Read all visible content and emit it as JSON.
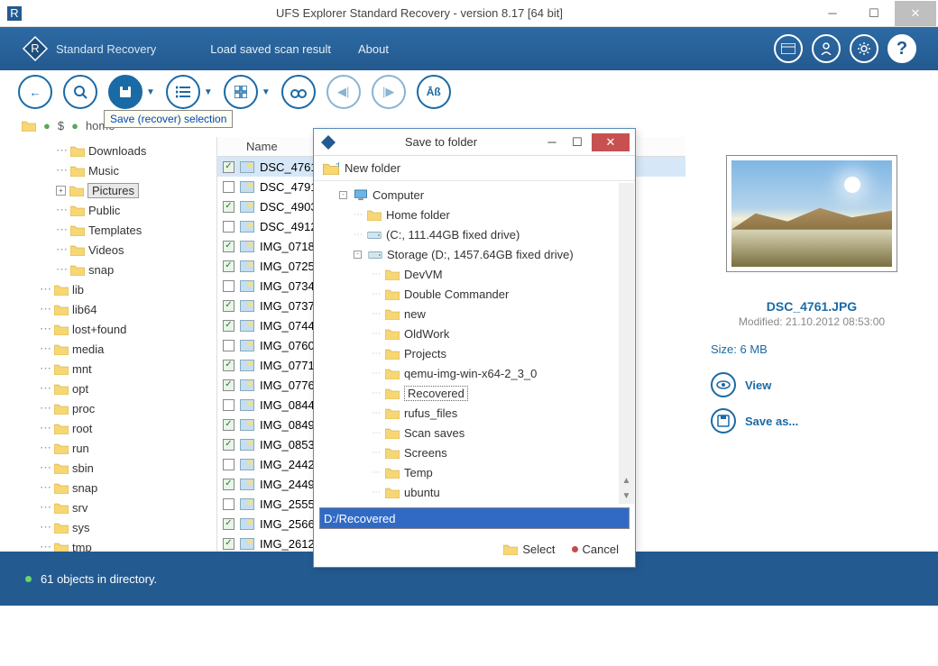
{
  "titlebar": {
    "title": "UFS Explorer Standard Recovery - version 8.17 [64 bit]"
  },
  "header": {
    "brand": "Standard Recovery",
    "menu": [
      "Load saved scan result",
      "About"
    ]
  },
  "toolbar": {
    "tooltip": "Save (recover) selection"
  },
  "breadcrumb": {
    "items": [
      "$",
      "home"
    ]
  },
  "tree": [
    {
      "label": "Downloads",
      "lvl": 2
    },
    {
      "label": "Music",
      "lvl": 2
    },
    {
      "label": "Pictures",
      "lvl": 2,
      "expand": "+",
      "selected": true
    },
    {
      "label": "Public",
      "lvl": 2
    },
    {
      "label": "Templates",
      "lvl": 2
    },
    {
      "label": "Videos",
      "lvl": 2
    },
    {
      "label": "snap",
      "lvl": 2
    },
    {
      "label": "lib",
      "lvl": 1
    },
    {
      "label": "lib64",
      "lvl": 1
    },
    {
      "label": "lost+found",
      "lvl": 1
    },
    {
      "label": "media",
      "lvl": 1
    },
    {
      "label": "mnt",
      "lvl": 1
    },
    {
      "label": "opt",
      "lvl": 1
    },
    {
      "label": "proc",
      "lvl": 1
    },
    {
      "label": "root",
      "lvl": 1
    },
    {
      "label": "run",
      "lvl": 1
    },
    {
      "label": "sbin",
      "lvl": 1
    },
    {
      "label": "snap",
      "lvl": 1
    },
    {
      "label": "srv",
      "lvl": 1
    },
    {
      "label": "sys",
      "lvl": 1
    },
    {
      "label": "tmp",
      "lvl": 1
    }
  ],
  "filelist": {
    "header": "Name",
    "rows": [
      {
        "name": "DSC_4761",
        "chk": true,
        "sel": true
      },
      {
        "name": "DSC_4791",
        "chk": false
      },
      {
        "name": "DSC_4903",
        "chk": true
      },
      {
        "name": "DSC_4912",
        "chk": false
      },
      {
        "name": "IMG_0718",
        "chk": true
      },
      {
        "name": "IMG_0725",
        "chk": true
      },
      {
        "name": "IMG_0734",
        "chk": false
      },
      {
        "name": "IMG_0737",
        "chk": true
      },
      {
        "name": "IMG_0744",
        "chk": true
      },
      {
        "name": "IMG_0760",
        "chk": false
      },
      {
        "name": "IMG_0771",
        "chk": true
      },
      {
        "name": "IMG_0776",
        "chk": true
      },
      {
        "name": "IMG_0844",
        "chk": false
      },
      {
        "name": "IMG_0849",
        "chk": true
      },
      {
        "name": "IMG_0853",
        "chk": true
      },
      {
        "name": "IMG_2442",
        "chk": false
      },
      {
        "name": "IMG_2449",
        "chk": true
      },
      {
        "name": "IMG_2555",
        "chk": false
      },
      {
        "name": "IMG_2566",
        "chk": true
      },
      {
        "name": "IMG_2612",
        "chk": true
      }
    ]
  },
  "preview": {
    "name": "DSC_4761.JPG",
    "modified": "Modified: 21.10.2012 08:53:00",
    "size": "Size: 6 MB",
    "view": "View",
    "saveas": "Save as..."
  },
  "status": "61 objects in directory.",
  "dialog": {
    "title": "Save to folder",
    "newfolder": "New folder",
    "tree": [
      {
        "label": "Computer",
        "lvl": 0,
        "expand": "-",
        "icon": "computer"
      },
      {
        "label": "Home folder",
        "lvl": 1,
        "icon": "folder"
      },
      {
        "label": "(C:, 111.44GB fixed drive)",
        "lvl": 1,
        "icon": "drive"
      },
      {
        "label": "Storage (D:, 1457.64GB fixed drive)",
        "lvl": 1,
        "expand": "-",
        "icon": "drive"
      },
      {
        "label": "DevVM",
        "lvl": 2,
        "icon": "folder"
      },
      {
        "label": "Double Commander",
        "lvl": 2,
        "icon": "folder"
      },
      {
        "label": "new",
        "lvl": 2,
        "icon": "folder"
      },
      {
        "label": "OldWork",
        "lvl": 2,
        "icon": "folder"
      },
      {
        "label": "Projects",
        "lvl": 2,
        "icon": "folder"
      },
      {
        "label": "qemu-img-win-x64-2_3_0",
        "lvl": 2,
        "icon": "folder"
      },
      {
        "label": "Recovered",
        "lvl": 2,
        "icon": "folder",
        "sel": true
      },
      {
        "label": "rufus_files",
        "lvl": 2,
        "icon": "folder"
      },
      {
        "label": "Scan saves",
        "lvl": 2,
        "icon": "folder"
      },
      {
        "label": "Screens",
        "lvl": 2,
        "icon": "folder"
      },
      {
        "label": "Temp",
        "lvl": 2,
        "icon": "folder"
      },
      {
        "label": "ubuntu",
        "lvl": 2,
        "icon": "folder"
      }
    ],
    "path": "D:/Recovered",
    "select": "Select",
    "cancel": "Cancel"
  }
}
